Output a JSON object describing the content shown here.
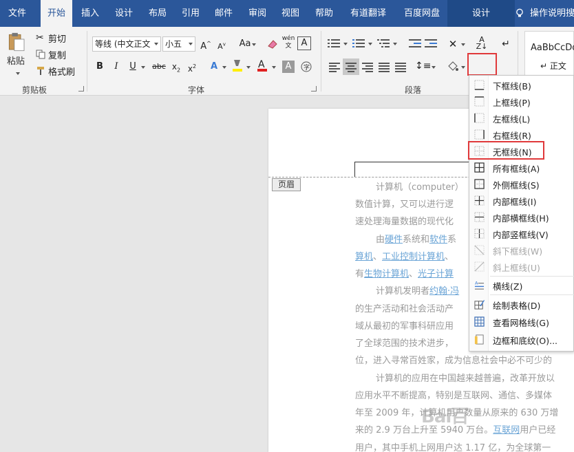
{
  "tabs": [
    {
      "label": "文件",
      "active": false
    },
    {
      "label": "开始",
      "active": true
    },
    {
      "label": "插入",
      "active": false
    },
    {
      "label": "设计",
      "active": false
    },
    {
      "label": "布局",
      "active": false
    },
    {
      "label": "引用",
      "active": false
    },
    {
      "label": "邮件",
      "active": false
    },
    {
      "label": "审阅",
      "active": false
    },
    {
      "label": "视图",
      "active": false
    },
    {
      "label": "帮助",
      "active": false
    },
    {
      "label": "有道翻译",
      "active": false
    },
    {
      "label": "百度网盘",
      "active": false
    }
  ],
  "context_tab": "设计",
  "tell_me": "操作说明搜索",
  "ribbon": {
    "clipboard": {
      "label": "剪贴板",
      "paste": "粘贴",
      "cut": "剪切",
      "copy": "复制",
      "format_painter": "格式刷"
    },
    "font": {
      "label": "字体",
      "font_name": "等线 (中文正文",
      "font_size": "小五"
    },
    "paragraph": {
      "label": "段落"
    },
    "styles": {
      "preview": "AaBbCcDd",
      "normal": "正文"
    }
  },
  "document": {
    "header_tag": "页眉",
    "lines": [
      {
        "text": "计算机（computer）"
      },
      {
        "text": "数值计算，又可以进行逻"
      },
      {
        "text": "速处理海量数据的现代化"
      },
      {
        "text": "由硬件系统和软件系"
      },
      {
        "text": "算机、工业控制计算机、"
      },
      {
        "text": "有生物计算机、光子计算"
      },
      {
        "text": "计算机发明者约翰·冯"
      },
      {
        "text": "的生产活动和社会活动产"
      },
      {
        "text": "域从最初的军事科研应用"
      },
      {
        "text": "了全球范围的技术进步，"
      },
      {
        "text": "位，进入寻常百姓家，成为信息社会中必不可少的"
      },
      {
        "text": "计算机的应用在中国越来越普遍，改革开放以"
      },
      {
        "text": "应用水平不断提高，特别是互联网、通信、多媒体"
      },
      {
        "text": "年至 2009 年，计算机用户数量从原来的 630 万增"
      },
      {
        "text": "来的 2.9 万台上升至 5940 万台。互联网用户已经"
      },
      {
        "text": "用户，其中手机上网用户达 1.17 亿，为全球第一"
      }
    ],
    "links": {
      "hardware": "硬件",
      "software": "软件",
      "industrial_computer": "工业控制计算机",
      "bio_computer": "生物计算机",
      "photon_computer": "光子计算",
      "inventor": "约翰·冯",
      "internet": "互联网"
    }
  },
  "border_menu": {
    "items": [
      {
        "label": "下框线(B)",
        "icon": "border-bottom-icon",
        "disabled": false
      },
      {
        "label": "上框线(P)",
        "icon": "border-top-icon",
        "disabled": false
      },
      {
        "label": "左框线(L)",
        "icon": "border-left-icon",
        "disabled": false
      },
      {
        "label": "右框线(R)",
        "icon": "border-right-icon",
        "disabled": false
      },
      {
        "label": "无框线(N)",
        "icon": "border-none-icon",
        "disabled": false
      },
      {
        "label": "所有框线(A)",
        "icon": "border-all-icon",
        "disabled": false
      },
      {
        "label": "外侧框线(S)",
        "icon": "border-outside-icon",
        "disabled": false
      },
      {
        "label": "内部框线(I)",
        "icon": "border-inside-icon",
        "disabled": false
      },
      {
        "label": "内部横框线(H)",
        "icon": "border-inside-horizontal-icon",
        "disabled": false
      },
      {
        "label": "内部竖框线(V)",
        "icon": "border-inside-vertical-icon",
        "disabled": false
      },
      {
        "label": "斜下框线(W)",
        "icon": "border-diagonal-down-icon",
        "disabled": true
      },
      {
        "label": "斜上框线(U)",
        "icon": "border-diagonal-up-icon",
        "disabled": true
      },
      {
        "label": "横线(Z)",
        "icon": "horizontal-line-icon",
        "disabled": false
      },
      {
        "label": "绘制表格(D)",
        "icon": "draw-table-icon",
        "disabled": false
      },
      {
        "label": "查看网格线(G)",
        "icon": "view-gridlines-icon",
        "disabled": false
      },
      {
        "label": "边框和底纹(O)...",
        "icon": "borders-shading-icon",
        "disabled": false
      }
    ]
  },
  "watermark": "Bai百"
}
